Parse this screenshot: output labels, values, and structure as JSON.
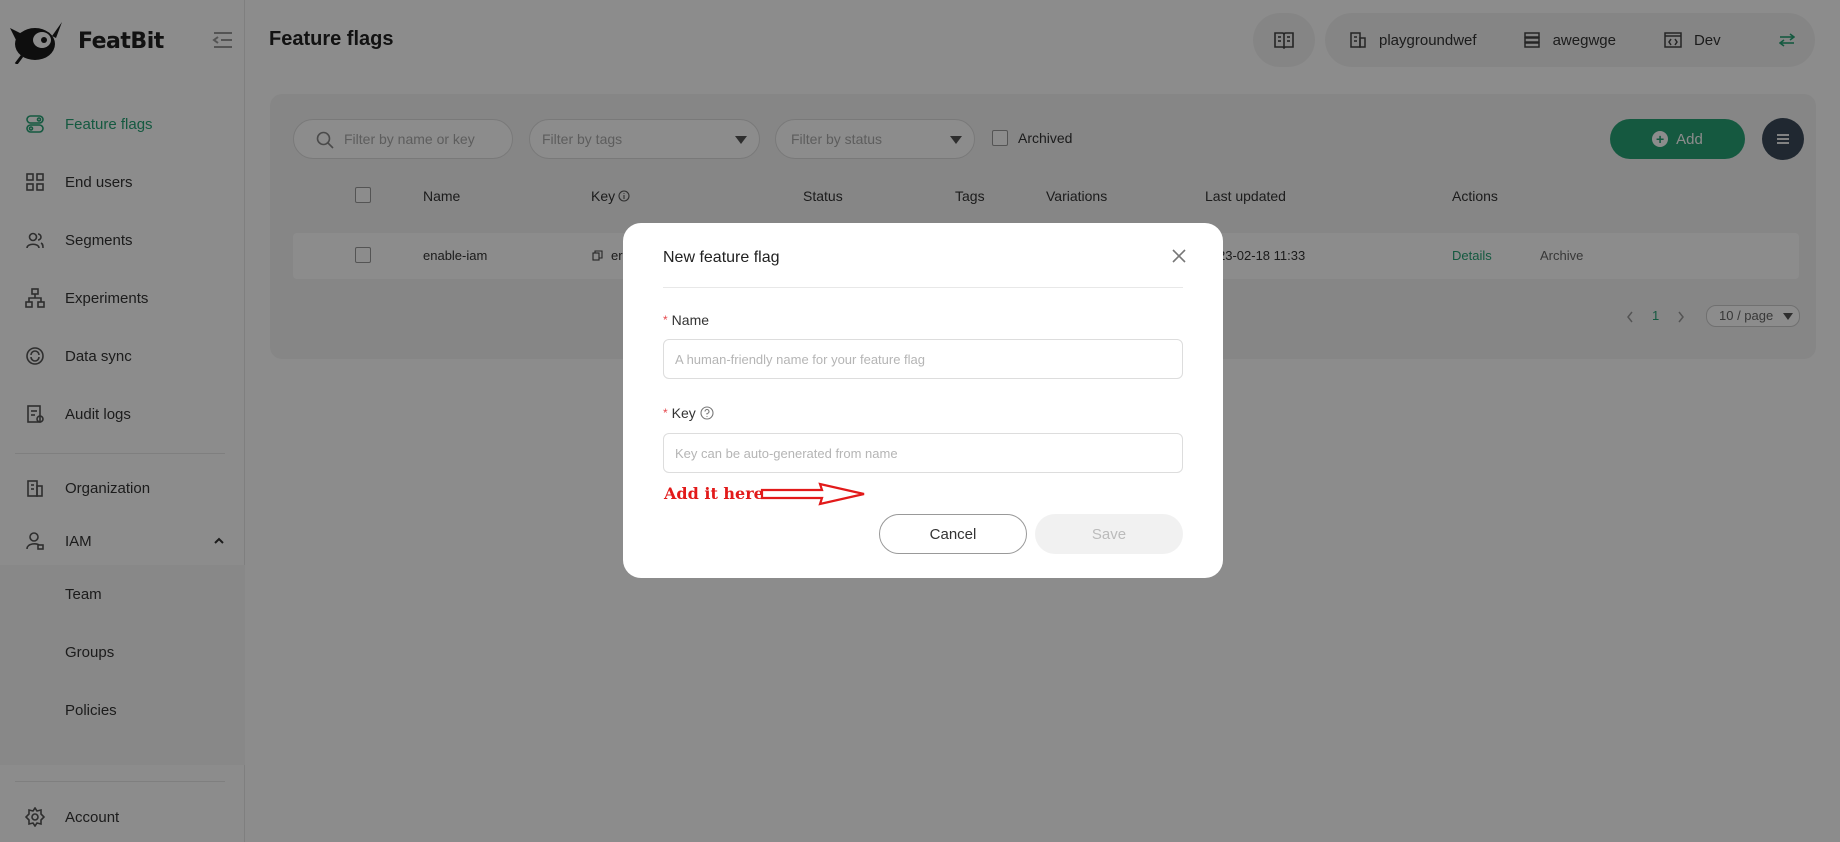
{
  "app": {
    "brand": "FeatBit",
    "page_title": "Feature flags"
  },
  "sidebar": {
    "items": [
      {
        "label": "Feature flags",
        "icon": "toggle-icon",
        "active": true
      },
      {
        "label": "End users",
        "icon": "grid-icon"
      },
      {
        "label": "Segments",
        "icon": "users-icon"
      },
      {
        "label": "Experiments",
        "icon": "hierarchy-icon"
      },
      {
        "label": "Data sync",
        "icon": "sync-icon"
      },
      {
        "label": "Audit logs",
        "icon": "audit-icon"
      },
      {
        "label": "Organization",
        "icon": "building-icon"
      },
      {
        "label": "IAM",
        "icon": "user-lock-icon"
      },
      {
        "label": "Team"
      },
      {
        "label": "Groups"
      },
      {
        "label": "Policies"
      },
      {
        "label": "Account",
        "icon": "gear-icon"
      }
    ]
  },
  "header": {
    "organization": "playgroundwef",
    "project": "awegwge",
    "environment": "Dev"
  },
  "filters": {
    "search_placeholder": "Filter by name or key",
    "tags_placeholder": "Filter by tags",
    "status_placeholder": "Filter by status",
    "archived_label": "Archived",
    "add_label": "Add"
  },
  "table": {
    "columns": [
      "Name",
      "Key",
      "Status",
      "Tags",
      "Variations",
      "Last updated",
      "Actions"
    ],
    "rows": [
      {
        "name": "enable-iam",
        "key": "er",
        "last_updated": "23-02-18 11:33",
        "action_details": "Details",
        "action_archive": "Archive"
      }
    ]
  },
  "pagination": {
    "current_page": "1",
    "page_size": "10 / page"
  },
  "modal": {
    "title": "New feature flag",
    "name_label": "Name",
    "name_placeholder": "A human-friendly name for your feature flag",
    "key_label": "Key",
    "key_placeholder": "Key can be auto-generated from name",
    "annotation": "Add it here",
    "cancel_label": "Cancel",
    "save_label": "Save",
    "required_mark": "*"
  },
  "colors": {
    "accent": "#27a376",
    "annotation": "#e21a1a",
    "menu_button": "#3b4a5a"
  }
}
